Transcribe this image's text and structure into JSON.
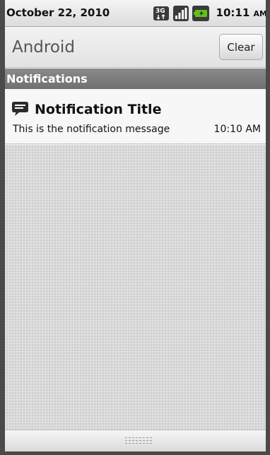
{
  "status_bar": {
    "date": "October 22, 2010",
    "time": "10:11",
    "ampm": "AM",
    "icons": [
      "3g-data-icon",
      "signal-strength-icon",
      "battery-charging-icon"
    ],
    "network_label": "3G"
  },
  "header": {
    "carrier": "Android",
    "clear_label": "Clear"
  },
  "section": {
    "title": "Notifications"
  },
  "notifications": [
    {
      "icon": "chat-bubble-icon",
      "title": "Notification Title",
      "message": "This is the notification message",
      "time": "10:10 AM"
    }
  ],
  "colors": {
    "section_bg": "#7d7d7d",
    "frame": "#4a4a4a",
    "battery_green": "#5fc21c"
  }
}
